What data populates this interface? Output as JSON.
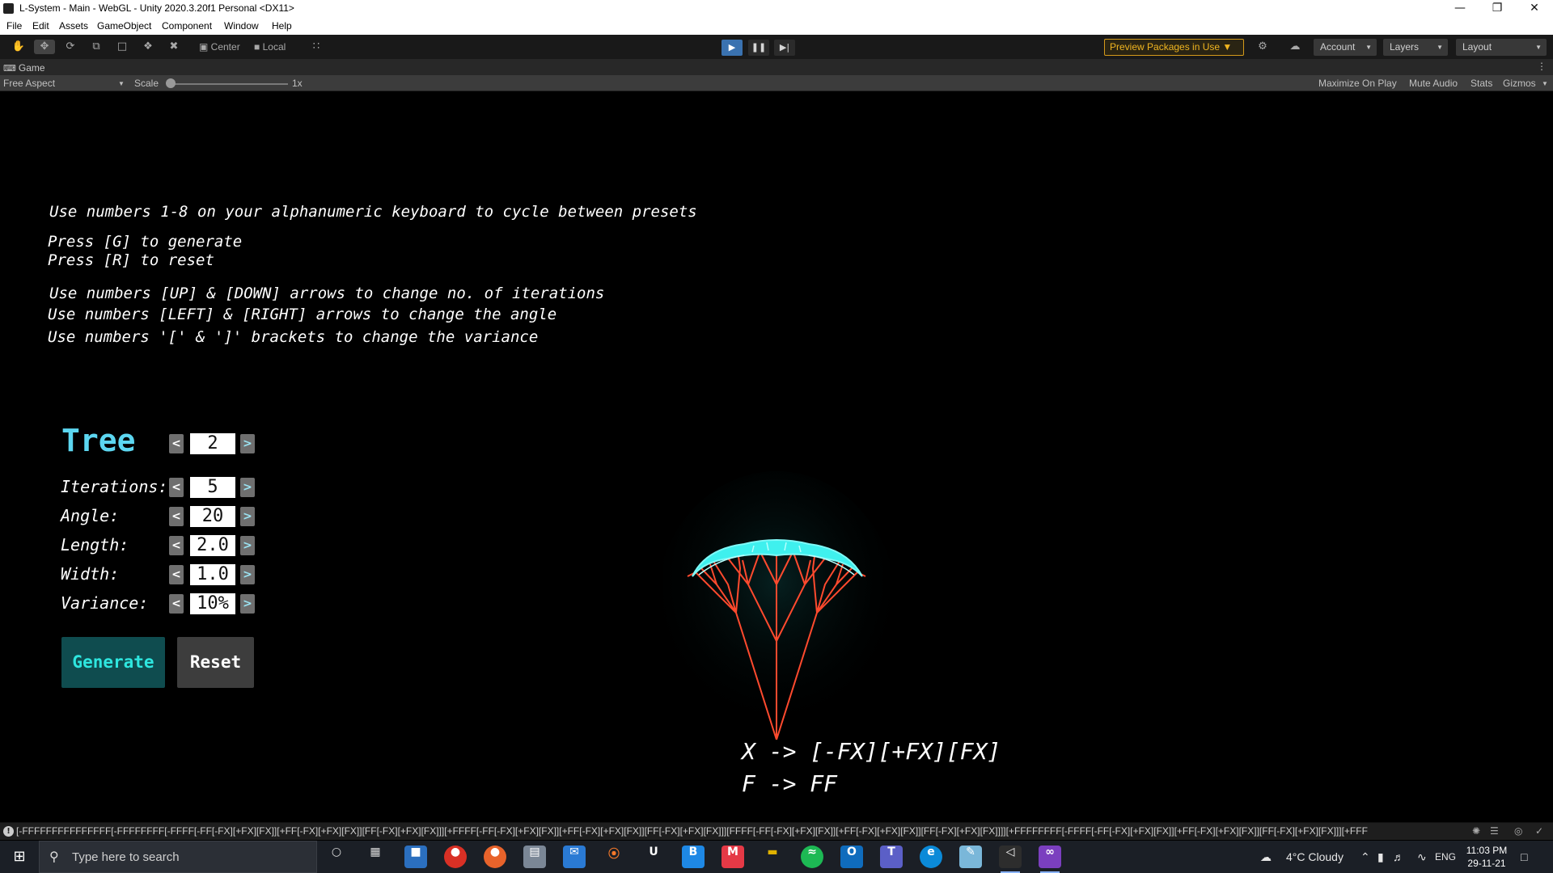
{
  "window": {
    "title": "L-System - Main - WebGL - Unity 2020.3.20f1 Personal <DX11>"
  },
  "menu": [
    "File",
    "Edit",
    "Assets",
    "GameObject",
    "Component",
    "Window",
    "Help"
  ],
  "toolbar": {
    "pivot_label": "Center",
    "space_label": "Local",
    "preview_packages_label": "Preview Packages in Use",
    "account_label": "Account",
    "layers_label": "Layers",
    "layout_label": "Layout",
    "play_active": true
  },
  "game_view": {
    "tab_label": "Game",
    "aspect_label": "Free Aspect",
    "scale_label": "Scale",
    "scale_value": "1x",
    "maximize_label": "Maximize On Play",
    "mute_label": "Mute Audio",
    "stats_label": "Stats",
    "gizmos_label": "Gizmos"
  },
  "instructions": {
    "presets": "Use numbers 1-8 on your alphanumeric keyboard to cycle between presets",
    "generate": "Press [G] to generate",
    "reset": "Press [R] to reset",
    "iterations": "Use numbers [UP] & [DOWN] arrows to change no. of iterations",
    "angle": "Use numbers [LEFT] & [RIGHT] arrows to change the angle",
    "variance": "Use numbers '[' & ']' brackets to change the variance"
  },
  "panel": {
    "preset_name": "Tree",
    "preset_value": "2",
    "params": [
      {
        "label": "Iterations:",
        "value": "5"
      },
      {
        "label": "Angle:",
        "value": "20"
      },
      {
        "label": "Length:",
        "value": "2.0"
      },
      {
        "label": "Width:",
        "value": "1.0"
      },
      {
        "label": "Variance:",
        "value": "10%"
      }
    ],
    "generate_label": "Generate",
    "reset_label": "Reset"
  },
  "rules": {
    "rule1": "X -> [-FX][+FX][FX]",
    "rule2": "F -> FF"
  },
  "status_bar": {
    "message": "[-FFFFFFFFFFFFFFF[-FFFFFFFF[-FFFF[-FF[-FX][+FX][FX]][+FF[-FX][+FX][FX]][FF[-FX][+FX][FX]]][+FFFF[-FF[-FX][+FX][FX]][+FF[-FX][+FX][FX]][FF[-FX][+FX][FX]]][FFFF[-FF[-FX][+FX][FX]][+FF[-FX][+FX][FX]][FF[-FX][+FX][FX]]]][+FFFFFFFF[-FFFF[-FF[-FX][+FX][FX]][+FF[-FX][+FX][FX]][FF[-FX][+FX][FX]]][+FFF"
  },
  "taskbar": {
    "search_placeholder": "Type here to search",
    "weather": "4°C  Cloudy",
    "language": "ENG",
    "time": "11:03 PM",
    "date": "29-11-21"
  },
  "colors": {
    "accent_cyan": "#5cd6f0",
    "generate_bg": "#0f4c4f",
    "branch_red": "#ff4a2e",
    "canopy_cyan": "#3ff0ee",
    "play_blue": "#3a72b0",
    "preview_orange": "#f0b520"
  }
}
